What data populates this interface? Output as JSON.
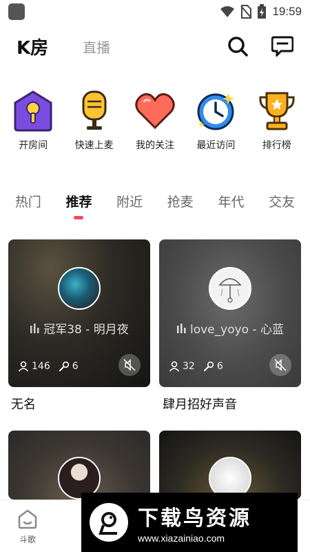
{
  "status_bar": {
    "time": "19:59"
  },
  "top_nav": {
    "tab_k": "K房",
    "tab_live": "直播"
  },
  "shortcuts": [
    {
      "label": "开房间",
      "icon": "mic-house-icon"
    },
    {
      "label": "快速上麦",
      "icon": "microphone-icon"
    },
    {
      "label": "我的关注",
      "icon": "heart-icon"
    },
    {
      "label": "最近访问",
      "icon": "clock-icon"
    },
    {
      "label": "排行榜",
      "icon": "trophy-icon"
    }
  ],
  "category_tabs": [
    "热门",
    "推荐",
    "附近",
    "抢麦",
    "年代",
    "交友"
  ],
  "active_tab": "推荐",
  "cards": [
    {
      "song": "冠军38 - 明月夜",
      "listeners": "146",
      "mics": "6",
      "title": "无名"
    },
    {
      "song": "love_yoyo - 心蓝",
      "listeners": "32",
      "mics": "6",
      "title": "肆月招好声音"
    }
  ],
  "bottom_nav": {
    "home_label": "斗歌"
  },
  "watermark": {
    "title": "下载鸟资源",
    "url": "www.xiazainiao.com"
  },
  "colors": {
    "accent": "#ee4b5e",
    "card_dark": "#141414"
  }
}
